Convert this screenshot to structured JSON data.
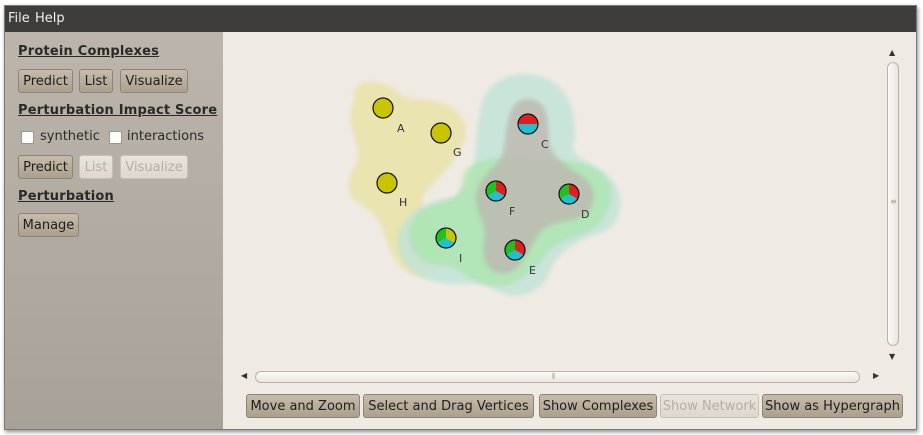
{
  "menu": {
    "file": "File",
    "help": "Help"
  },
  "sidebar": {
    "protein_complexes": {
      "title": "Protein Complexes",
      "predict": "Predict",
      "list": "List",
      "visualize": "Visualize"
    },
    "perturbation_impact": {
      "title": "Perturbation Impact Score",
      "synthetic_label": "synthetic",
      "synthetic_checked": false,
      "interactions_label": "interactions",
      "interactions_checked": false,
      "predict": "Predict",
      "list": "List",
      "list_enabled": false,
      "visualize": "Visualize",
      "visualize_enabled": false
    },
    "perturbation": {
      "title": "Perturbation",
      "manage": "Manage"
    }
  },
  "graph": {
    "vertices": [
      {
        "id": "A",
        "label": "A",
        "kind": "single",
        "colors": [
          "#c8c400"
        ]
      },
      {
        "id": "G",
        "label": "G",
        "kind": "single",
        "colors": [
          "#c8c400"
        ]
      },
      {
        "id": "H",
        "label": "H",
        "kind": "single",
        "colors": [
          "#c8c400"
        ]
      },
      {
        "id": "C",
        "label": "C",
        "kind": "pie",
        "colors": [
          "#e02020",
          "#20c0d0"
        ]
      },
      {
        "id": "F",
        "label": "F",
        "kind": "pie",
        "colors": [
          "#e02020",
          "#20c0d0",
          "#20c020"
        ]
      },
      {
        "id": "D",
        "label": "D",
        "kind": "pie",
        "colors": [
          "#e02020",
          "#20c0d0",
          "#20c020"
        ]
      },
      {
        "id": "E",
        "label": "E",
        "kind": "pie",
        "colors": [
          "#e02020",
          "#20c0d0",
          "#20c020"
        ]
      },
      {
        "id": "I",
        "label": "I",
        "kind": "pie",
        "colors": [
          "#c8c400",
          "#20c0d0",
          "#20c020"
        ]
      }
    ],
    "complex_colors": {
      "yellow": "#e8e2a0",
      "cyan": "#bfe3d8",
      "green": "#a8e6a8",
      "gray": "#bdb8b0"
    }
  },
  "toolbar": {
    "move_zoom": "Move and Zoom",
    "select_drag": "Select and Drag Vertices",
    "show_complexes": "Show Complexes",
    "show_network": "Show Network",
    "show_network_enabled": false,
    "show_hypergraph": "Show as Hypergraph"
  }
}
